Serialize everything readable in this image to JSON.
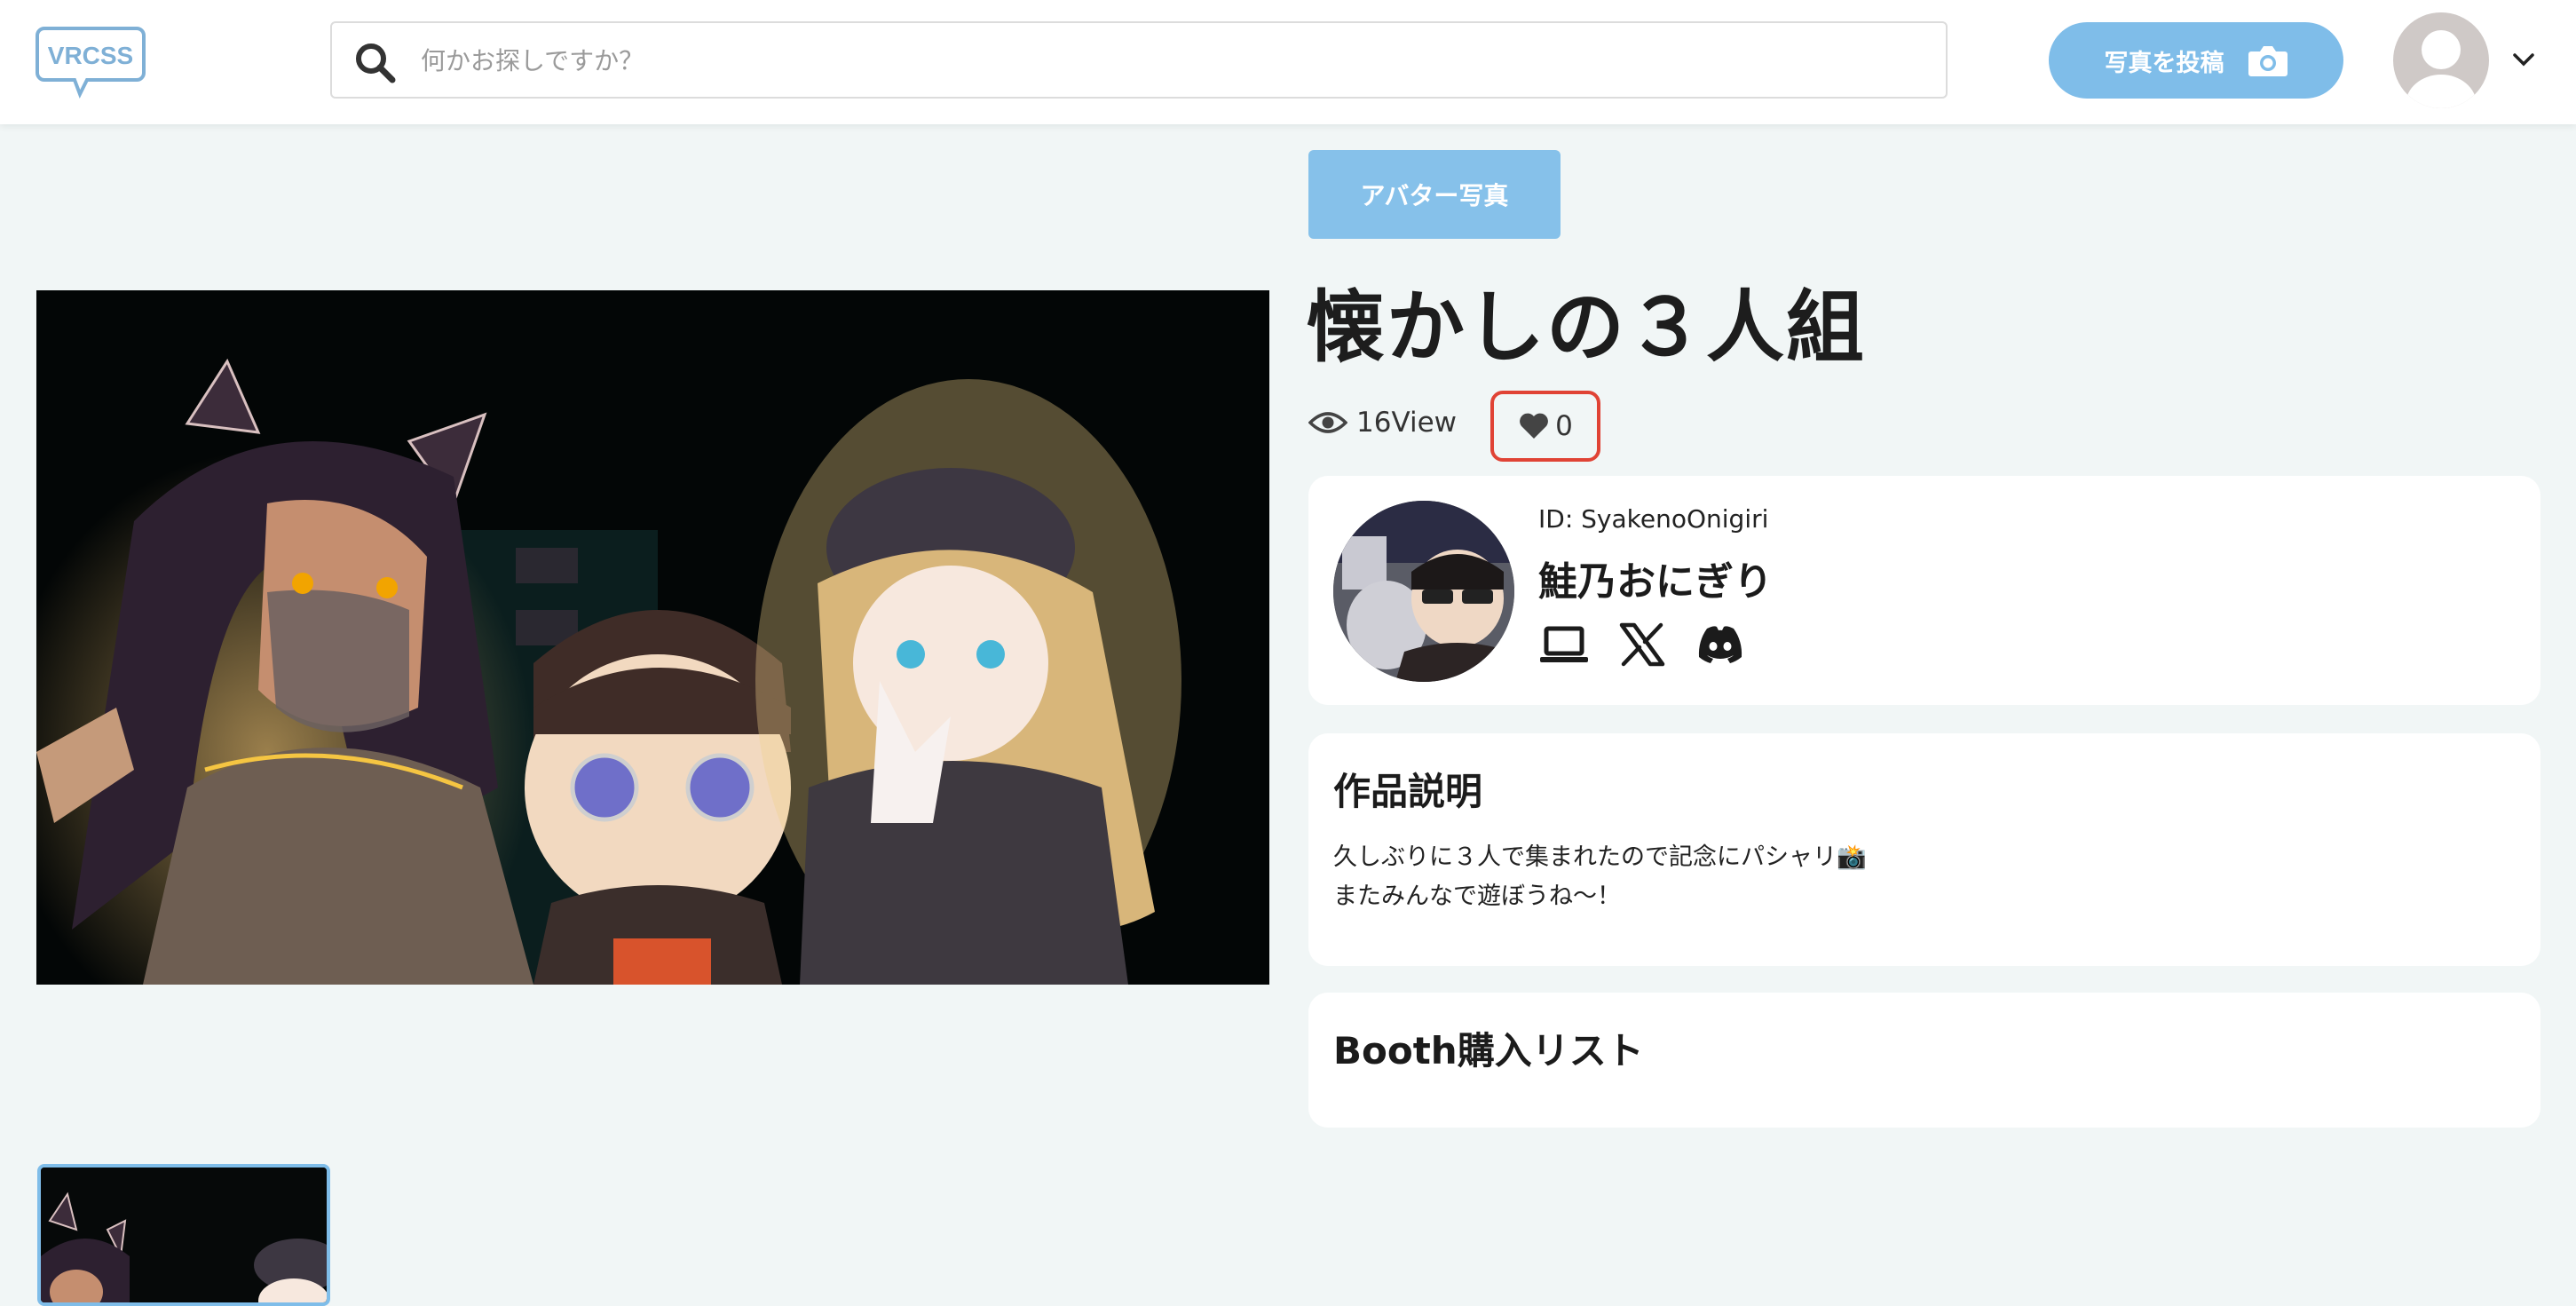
{
  "header": {
    "logo_text": "VRCSS",
    "search_placeholder": "何かお探しですか？",
    "post_button_label": "写真を投稿",
    "accent_color": "#7fbde9"
  },
  "post": {
    "category_label": "アバター写真",
    "title": "懐かしの３人組",
    "views": "16View",
    "likes": "0"
  },
  "author": {
    "id_line": "ID: SyakenoOnigiri",
    "name": "鮭乃おにぎり",
    "social_icons": [
      "laptop-icon",
      "x-icon",
      "discord-icon"
    ]
  },
  "description": {
    "heading": "作品説明",
    "text": "久しぶりに３人で集まれたので記念にパシャリ📸\nまたみんなで遊ぼうね〜！"
  },
  "booth": {
    "heading": "Booth購入リスト"
  }
}
